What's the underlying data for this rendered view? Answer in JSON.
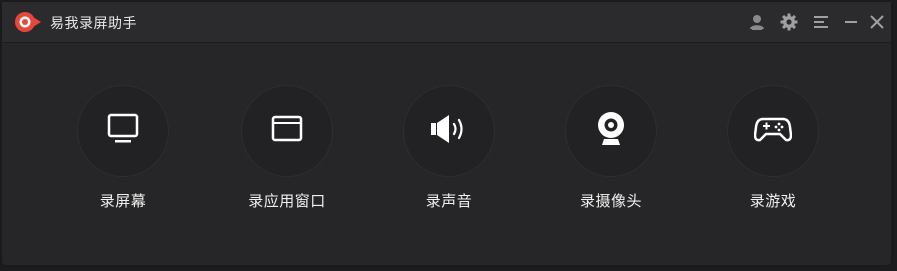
{
  "app": {
    "title": "易我录屏助手",
    "logo_icon": "record-logo-icon",
    "accent_color": "#e8473b"
  },
  "window_controls": [
    {
      "name": "account-icon"
    },
    {
      "name": "settings-icon"
    },
    {
      "name": "menu-icon"
    },
    {
      "name": "minimize-icon"
    },
    {
      "name": "close-icon"
    }
  ],
  "features": [
    {
      "label": "录屏幕",
      "icon": "monitor-icon"
    },
    {
      "label": "录应用窗口",
      "icon": "window-icon"
    },
    {
      "label": "录声音",
      "icon": "speaker-icon"
    },
    {
      "label": "录摄像头",
      "icon": "webcam-icon"
    },
    {
      "label": "录游戏",
      "icon": "gamepad-icon"
    }
  ]
}
